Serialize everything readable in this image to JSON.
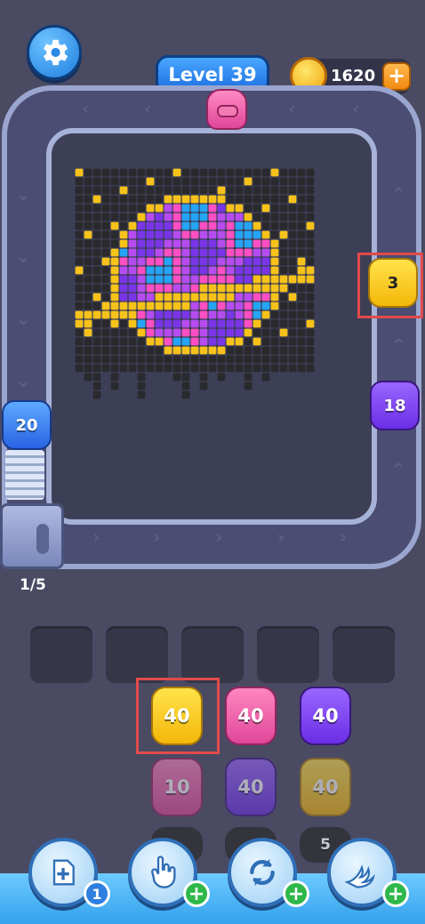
{
  "header": {
    "settings_icon": "gear-icon",
    "level_label": "Level 39",
    "coins": "1620",
    "coin_add_label": "+"
  },
  "track_shooters": [
    {
      "color": "#f4c10a",
      "count": "3"
    },
    {
      "color": "#7a3ef0",
      "count": "18"
    },
    {
      "color": "#3f86f5",
      "count": "20"
    }
  ],
  "queue": {
    "progress": "1/5"
  },
  "gun_grid": {
    "row1": [
      {
        "color": "#f8c814",
        "count": "40"
      },
      {
        "color": "#f0509e",
        "count": "40"
      },
      {
        "color": "#7d3bf0",
        "count": "40"
      }
    ],
    "row2": [
      {
        "color": "#f0509e",
        "count": "10"
      },
      {
        "color": "#7d3bf0",
        "count": "40"
      },
      {
        "color": "#f8c814",
        "count": "40"
      }
    ],
    "row3": [
      {
        "color": "#2b2b2e",
        "count": ""
      },
      {
        "color": "#2b2b2e",
        "count": ""
      },
      {
        "color": "#2b2b2e",
        "count": "5"
      }
    ]
  },
  "tools": [
    {
      "icon": "add-slot-icon",
      "badge": "1"
    },
    {
      "icon": "hand-pointer-icon",
      "badge": "+"
    },
    {
      "icon": "refresh-icon",
      "badge": "+"
    },
    {
      "icon": "wing-icon",
      "badge": "+"
    }
  ],
  "colors": {
    "background": "#4a4a63",
    "track": "#9aa6cf",
    "accent_blue": "#1f7ee0"
  }
}
